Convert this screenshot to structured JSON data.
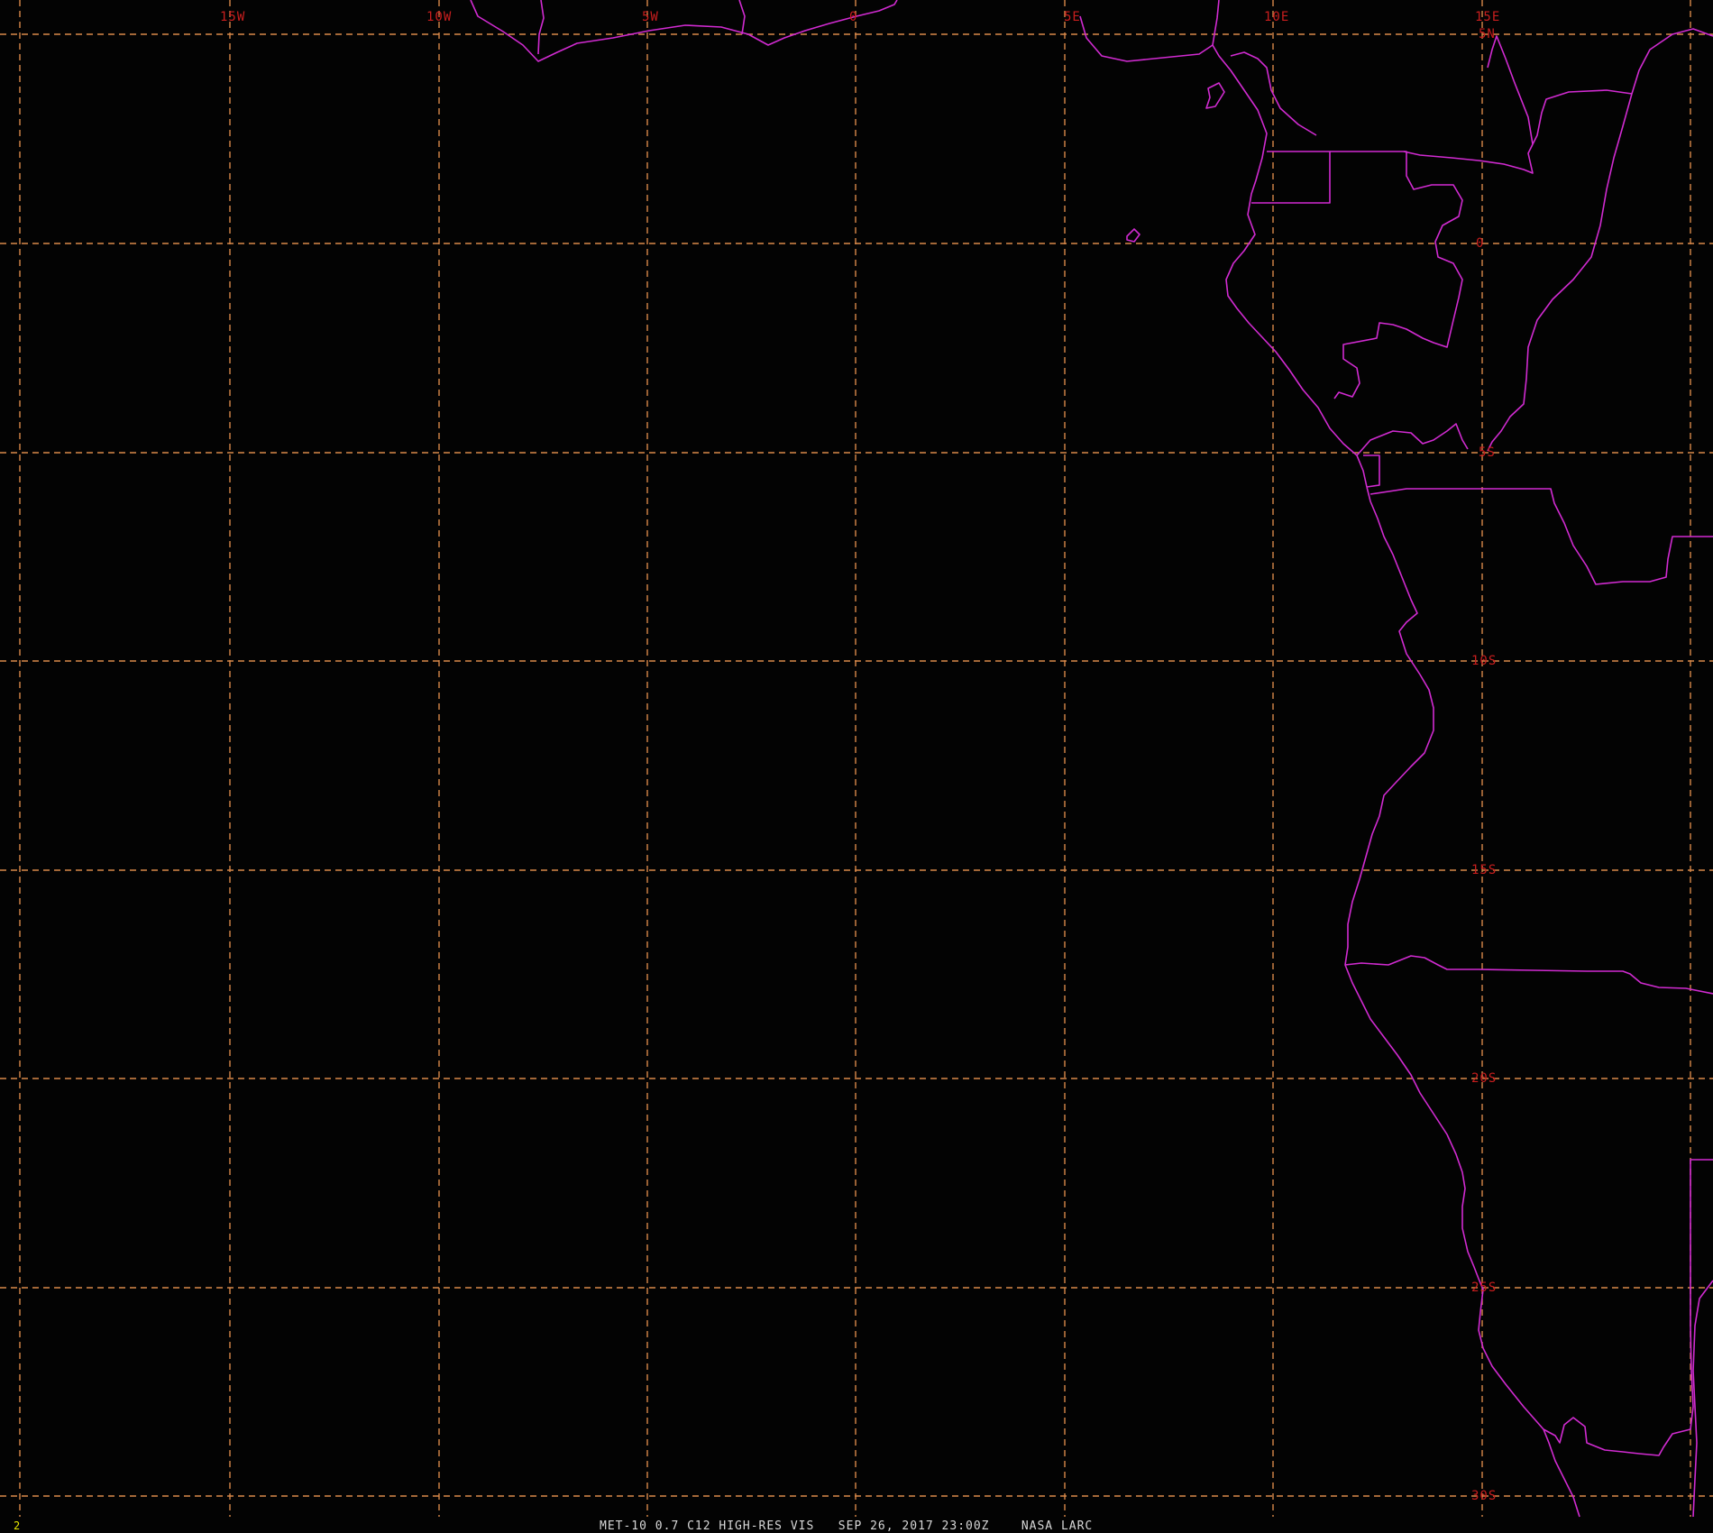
{
  "map": {
    "caption": "MET-10 0.7 C12 HIGH-RES VIS   SEP 26, 2017 23:00Z    NASA LARC",
    "frame_number": "2",
    "colors": {
      "background": "#030303",
      "gridline": "#d9894a",
      "grid_label": "#c81e1e",
      "coastline": "#d12bd1",
      "caption": "#d8d8d8",
      "frame_number": "#e6e600"
    },
    "longitude_labels": [
      "15W",
      "10W",
      "5W",
      "0",
      "5E",
      "10E",
      "15E"
    ],
    "latitude_labels": [
      "5N",
      "0",
      "5S",
      "10S",
      "15S",
      "20S",
      "25S",
      "30S"
    ]
  }
}
